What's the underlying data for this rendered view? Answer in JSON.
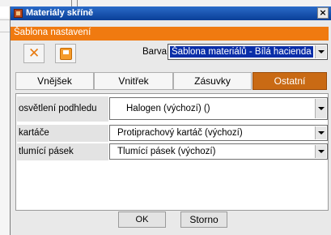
{
  "window": {
    "title": "Materiály skříně",
    "close_label": "×"
  },
  "section": {
    "title": "Šablona nastavení"
  },
  "toolbar": {
    "cancel_icon": "x-icon",
    "save_icon": "save-icon"
  },
  "barva": {
    "label": "Barva",
    "value": "Šablona materiálů - Bílá hacienda"
  },
  "tabs": [
    {
      "label": "Vnějšek",
      "active": false
    },
    {
      "label": "Vnitřek",
      "active": false
    },
    {
      "label": "Zásuvky",
      "active": false
    },
    {
      "label": "Ostatní",
      "active": true
    }
  ],
  "properties": [
    {
      "label": "osvětlení podhledu",
      "value": "Halogen (výchozí) ()"
    },
    {
      "label": "kartáče",
      "value": "Protiprachový kartáč (výchozí)"
    },
    {
      "label": "tlumící pásek",
      "value": "Tlumící pásek (výchozí)"
    }
  ],
  "buttons": {
    "ok": "OK",
    "cancel": "Storno"
  },
  "colors": {
    "accent": "#f07a10",
    "active_tab": "#c96a14",
    "titlebar": "#0a3f98",
    "selection": "#0a2ea8"
  }
}
